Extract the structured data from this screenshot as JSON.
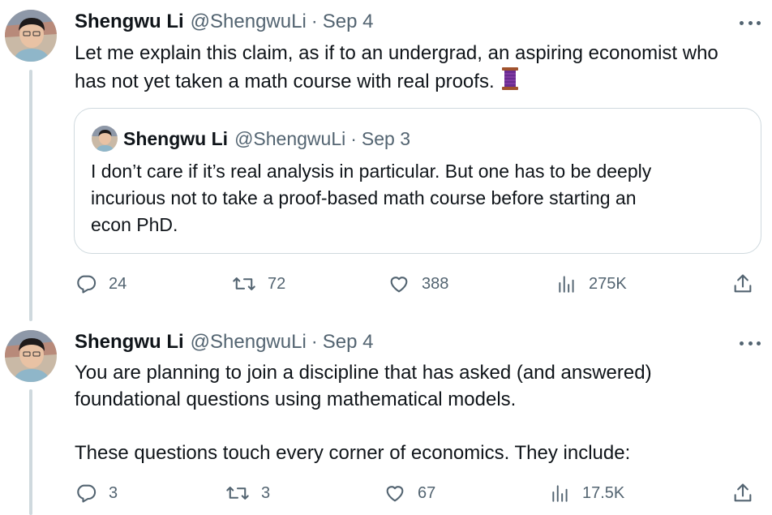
{
  "tweets": [
    {
      "author": {
        "name": "Shengwu Li",
        "handle": "@ShengwuLi",
        "date": "Sep 4"
      },
      "separator": "·",
      "text_lines": [
        "Let me explain this claim, as if to an undergrad, an aspiring economist who",
        "has not yet taken a math course with real proofs."
      ],
      "emoji": "thread-spool",
      "quote": {
        "author": {
          "name": "Shengwu Li",
          "handle": "@ShengwuLi",
          "date": "Sep 3"
        },
        "text_lines": [
          "I don’t care if it’s real analysis in particular. But one has to be deeply",
          "incurious not to take a proof-based math course before starting an",
          "econ PhD."
        ]
      },
      "actions": {
        "replies": "24",
        "reposts": "72",
        "likes": "388",
        "views": "275K"
      }
    },
    {
      "author": {
        "name": "Shengwu Li",
        "handle": "@ShengwuLi",
        "date": "Sep 4"
      },
      "separator": "·",
      "text_lines": [
        "You are planning to join a discipline that has asked (and answered)",
        "foundational questions using mathematical models."
      ],
      "text_lines_2": [
        "These questions touch every corner of economics. They include:"
      ],
      "actions": {
        "replies": "3",
        "reposts": "3",
        "likes": "67",
        "views": "17.5K"
      }
    }
  ],
  "colors": {
    "text": "#0f1419",
    "secondary": "#536471",
    "border": "#cfd9de",
    "thread_line": "#cfd9de"
  }
}
